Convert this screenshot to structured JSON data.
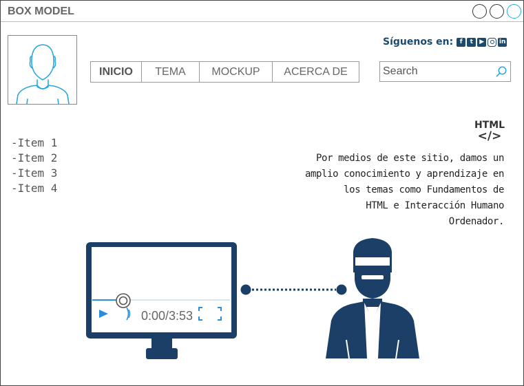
{
  "window": {
    "title": "BOX MODEL"
  },
  "social": {
    "label": "Síguenos en:",
    "icons": [
      "facebook-icon",
      "twitter-icon",
      "youtube-icon",
      "instagram-icon",
      "linkedin-icon"
    ]
  },
  "nav": {
    "items": [
      {
        "label": "INICIO",
        "active": true
      },
      {
        "label": "TEMA"
      },
      {
        "label": "MOCKUP"
      },
      {
        "label": "ACERCA DE"
      }
    ]
  },
  "search": {
    "placeholder": "Search"
  },
  "sidebar": {
    "items": [
      "-Item 1",
      "-Item 2",
      "-Item 3",
      "-Item 4"
    ]
  },
  "badge": {
    "title": "HTML",
    "code": "</>"
  },
  "about": {
    "lines": [
      "Por medios de este sitio, damos un",
      "amplio conocimiento y aprendizaje en",
      "los temas como Fundamentos de",
      "HTML e Interacción Humano",
      "Ordenador."
    ]
  },
  "player": {
    "time": "0:00/3:53",
    "progress": 0.24
  },
  "colors": {
    "accent": "#1a4a70",
    "window_button_active": "#29a8e0",
    "player_blue": "#2a8fd8"
  }
}
